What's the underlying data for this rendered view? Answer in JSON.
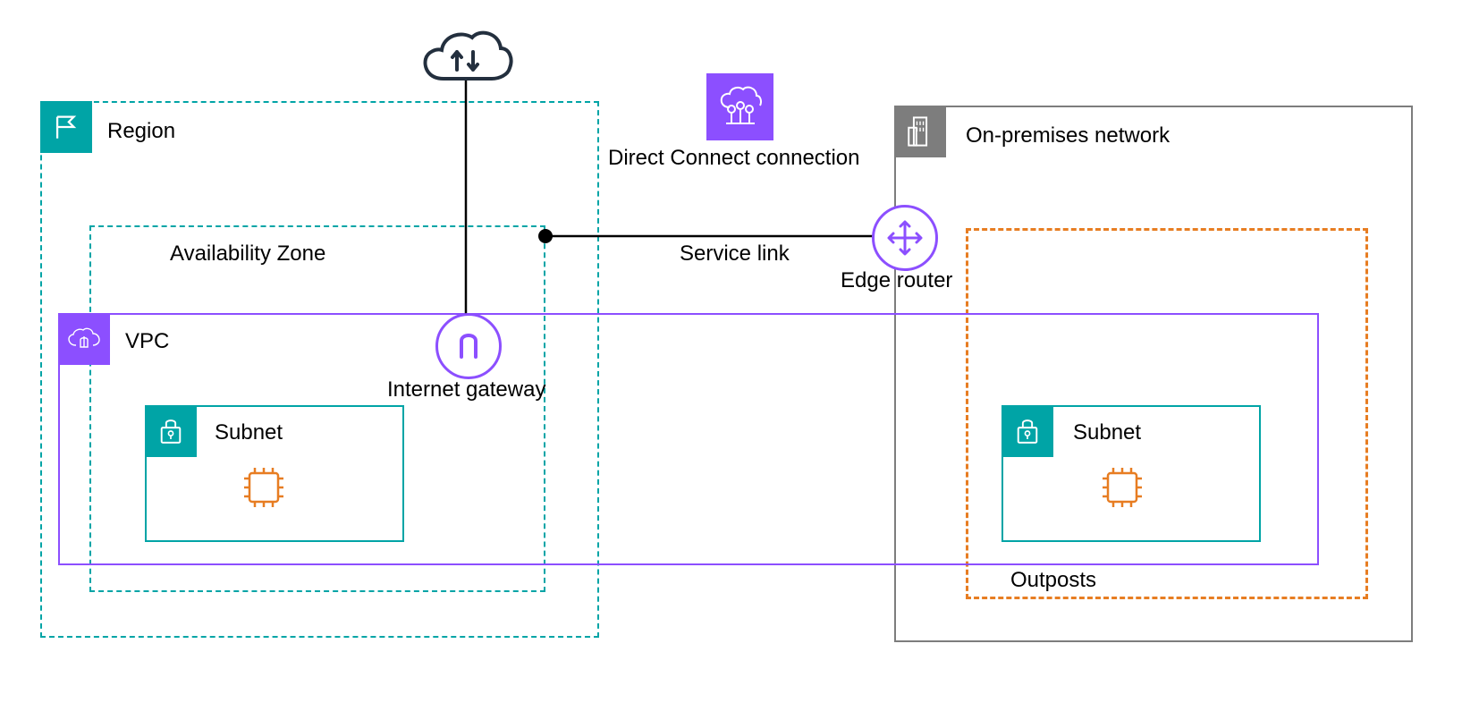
{
  "region": {
    "label": "Region"
  },
  "az": {
    "label": "Availability Zone"
  },
  "vpc": {
    "label": "VPC"
  },
  "subnet1": {
    "label": "Subnet"
  },
  "subnet2": {
    "label": "Subnet"
  },
  "onprem": {
    "label": "On-premises network"
  },
  "outposts": {
    "label": "Outposts"
  },
  "igw": {
    "label": "Internet gateway"
  },
  "edge": {
    "label": "Edge router"
  },
  "svclink": {
    "label": "Service link"
  },
  "dx": {
    "label": "Direct Connect connection"
  },
  "colors": {
    "teal": "#00a4a6",
    "purple": "#8c4fff",
    "orange": "#e77d22",
    "grey": "#7d7d7d",
    "dark": "#232f3e"
  }
}
